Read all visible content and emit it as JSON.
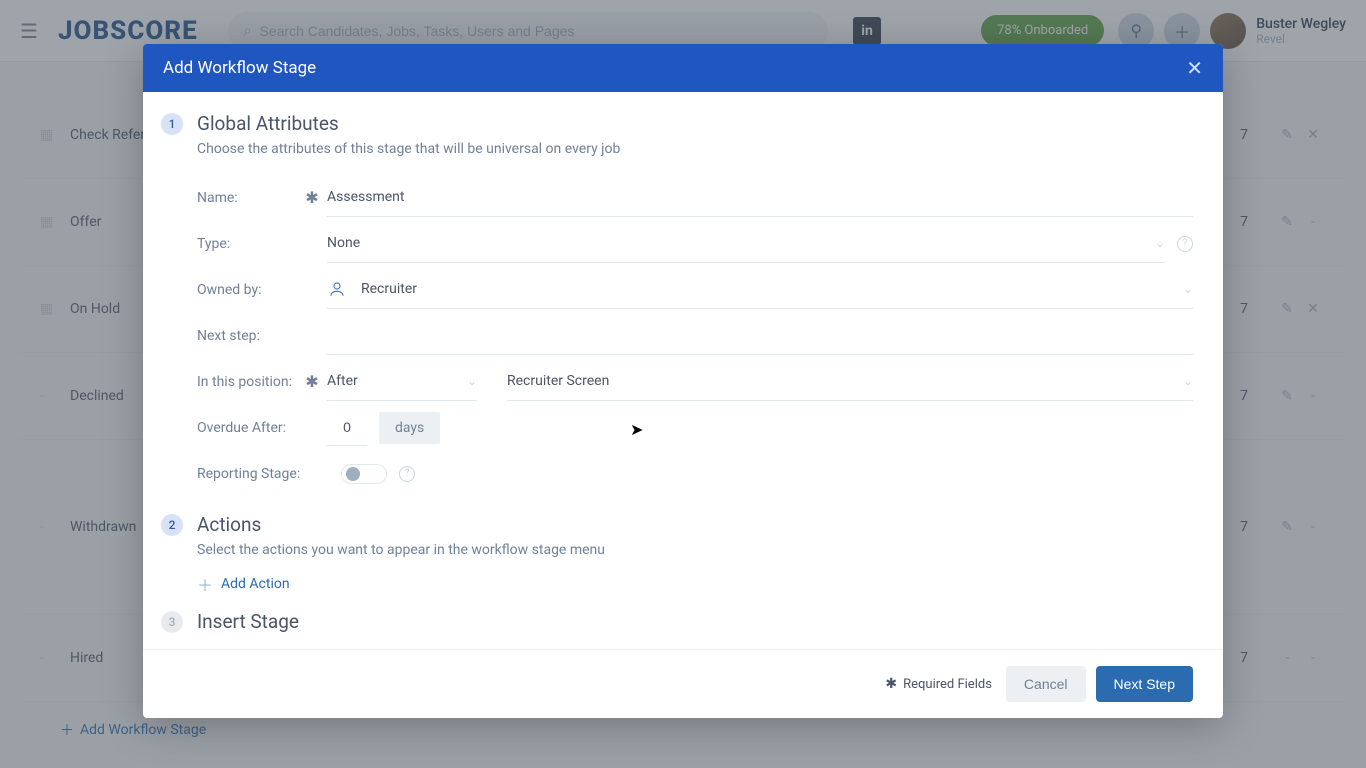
{
  "header": {
    "logo": "JOBSCORE",
    "search_placeholder": "Search Candidates, Jobs, Tasks, Users and Pages",
    "onboarded": "78% Onboarded",
    "user_name": "Buster Wegley",
    "user_company": "Revel"
  },
  "bg_rows": [
    {
      "drag": "grid",
      "label": "Check References",
      "count": "7",
      "a1": "edit",
      "a2": "delete"
    },
    {
      "drag": "grid",
      "label": "Offer",
      "count": "7",
      "a1": "edit",
      "a2": "-"
    },
    {
      "drag": "grid",
      "label": "On Hold",
      "count": "7",
      "a1": "edit",
      "a2": "delete"
    },
    {
      "drag": "-",
      "label": "Declined",
      "count": "7",
      "a1": "edit",
      "a2": "-"
    },
    {
      "drag": "-",
      "label": "Withdrawn",
      "count": "7",
      "a1": "edit",
      "a2": "-"
    },
    {
      "drag": "-",
      "label": "Hired",
      "count": "7",
      "a1": "-",
      "a2": "-"
    }
  ],
  "add_workflow": "Add Workflow Stage",
  "modal": {
    "title": "Add Workflow Stage",
    "section1": {
      "badge": "1",
      "title": "Global Attributes",
      "desc": "Choose the attributes of this stage that will be universal on every job"
    },
    "fields": {
      "name_label": "Name:",
      "name_value": "Assessment",
      "type_label": "Type:",
      "type_value": "None",
      "owned_label": "Owned by:",
      "owned_value": "Recruiter",
      "next_label": "Next step:",
      "pos_label": "In this position:",
      "pos_rel": "After",
      "pos_stage": "Recruiter Screen",
      "overdue_label": "Overdue After:",
      "overdue_value": "0",
      "overdue_unit": "days",
      "reporting_label": "Reporting Stage:"
    },
    "section2": {
      "badge": "2",
      "title": "Actions",
      "desc": "Select the actions you want to appear in the workflow stage menu",
      "add_action": "Add Action"
    },
    "section3": {
      "badge": "3",
      "title": "Insert Stage"
    },
    "footer": {
      "required": "Required Fields",
      "cancel": "Cancel",
      "next": "Next Step"
    }
  }
}
